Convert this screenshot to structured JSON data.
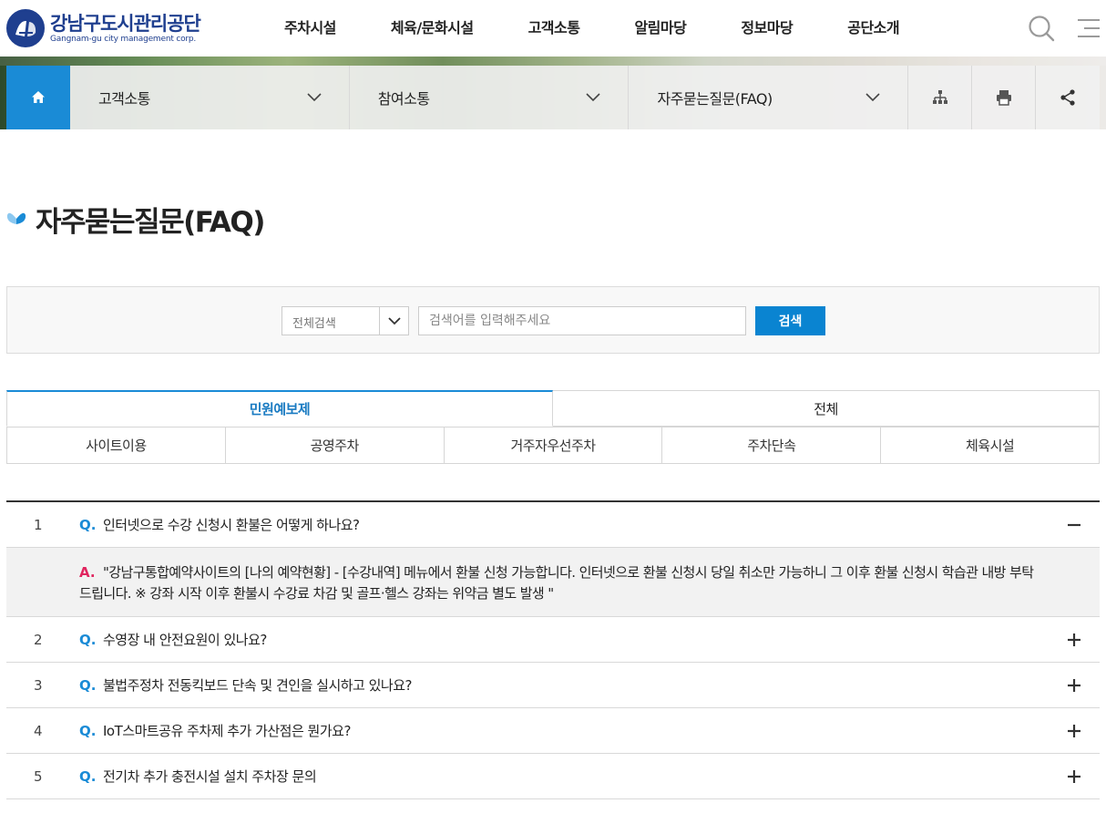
{
  "header": {
    "logo_kr": "강남구도시관리공단",
    "logo_en": "Gangnam-gu city management corp.",
    "nav": [
      "주차시설",
      "체육/문화시설",
      "고객소통",
      "알림마당",
      "정보마당",
      "공단소개"
    ],
    "search_icon": "search-icon",
    "menu_icon": "hamburger-menu-icon"
  },
  "subnav": {
    "home_icon": "home-icon",
    "depth1": "고객소통",
    "depth2": "참여소통",
    "depth3": "자주묻는질문(FAQ)",
    "tools": [
      "sitemap-icon",
      "print-icon",
      "share-icon"
    ]
  },
  "page": {
    "title": "자주묻는질문(FAQ)"
  },
  "search": {
    "select_value": "전체검색",
    "placeholder": "검색어를 입력해주세요",
    "button": "검색"
  },
  "tabs": {
    "top": [
      "민원예보제",
      "전체"
    ],
    "sub": [
      "사이트이용",
      "공영주차",
      "거주자우선주차",
      "주차단속",
      "체육시설"
    ]
  },
  "faq": {
    "q_mark": "Q.",
    "a_mark": "A.",
    "items": [
      {
        "num": "1",
        "question": "인터넷으로 수강 신청시 환불은 어떻게 하나요?",
        "expanded": true,
        "answer": "\"강남구통합예약사이트의 [나의 예약현황] - [수강내역] 메뉴에서 환불 신청 가능합니다. 인터넷으로 환불 신청시 당일 취소만 가능하니 그 이후 환불 신청시 학습관 내방 부탁드립니다. ※ 강좌 시작 이후 환불시 수강료 차감 및 골프·헬스 강좌는 위약금 별도 발생 \""
      },
      {
        "num": "2",
        "question": "수영장 내 안전요원이 있나요?",
        "expanded": false
      },
      {
        "num": "3",
        "question": "불법주정차 전동킥보드 단속 및 견인을 실시하고 있나요?",
        "expanded": false
      },
      {
        "num": "4",
        "question": "IoT스마트공유 주차제 추가 가산점은 뭔가요?",
        "expanded": false
      },
      {
        "num": "5",
        "question": "전기차 추가 충전시설 설치 주차장 문의",
        "expanded": false
      }
    ]
  },
  "colors": {
    "brand_navy": "#1f3f8f",
    "accent_blue": "#1a8bd6",
    "answer_mark": "#e0245e"
  }
}
